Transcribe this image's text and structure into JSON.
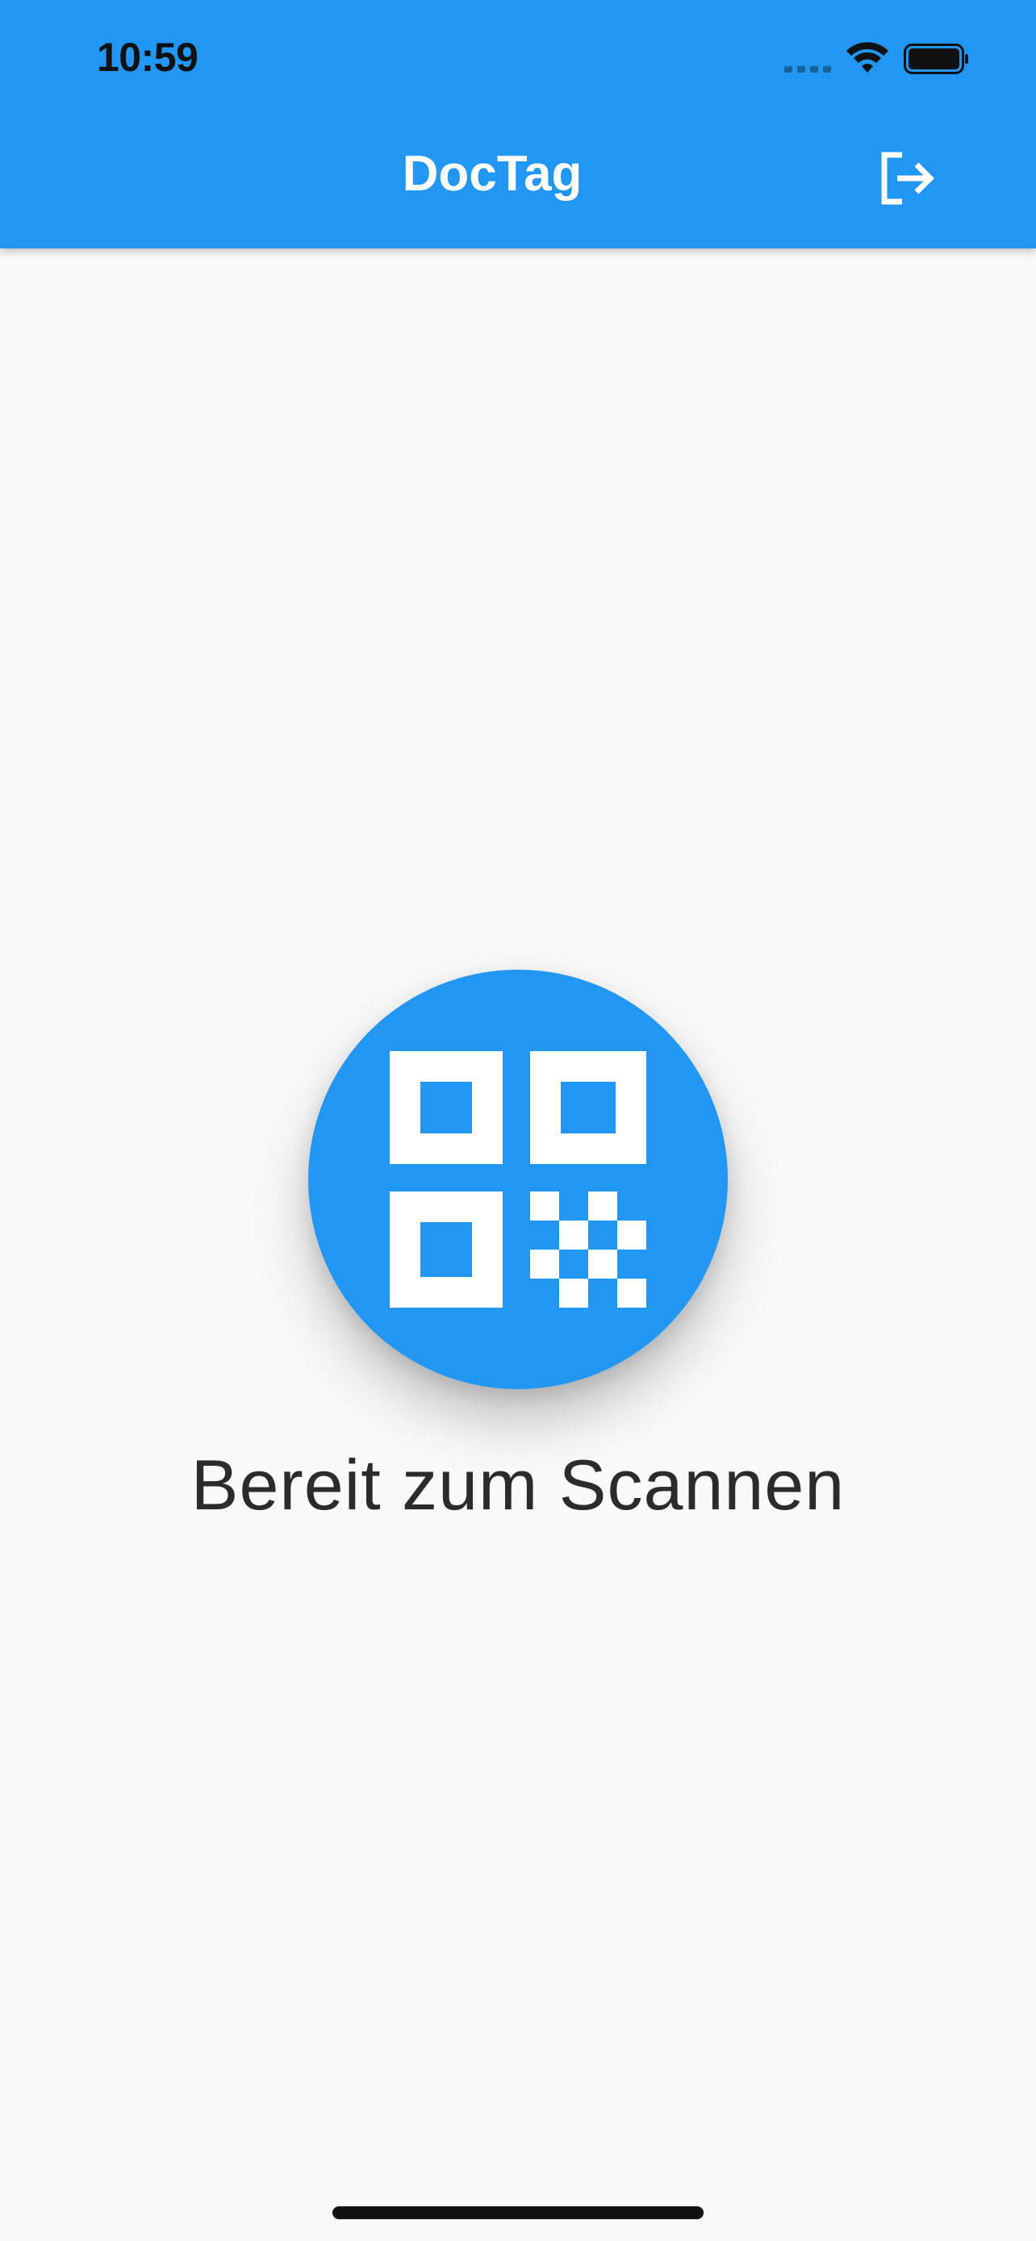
{
  "status_bar": {
    "time": "10:59"
  },
  "app_bar": {
    "title": "DocTag",
    "logout_icon": "logout-icon"
  },
  "main": {
    "scan_icon": "qr-code-icon",
    "status_text": "Bereit zum Scannen"
  },
  "colors": {
    "primary": "#2196f3",
    "background": "#f9f9f9",
    "text": "#2b2b2b"
  }
}
